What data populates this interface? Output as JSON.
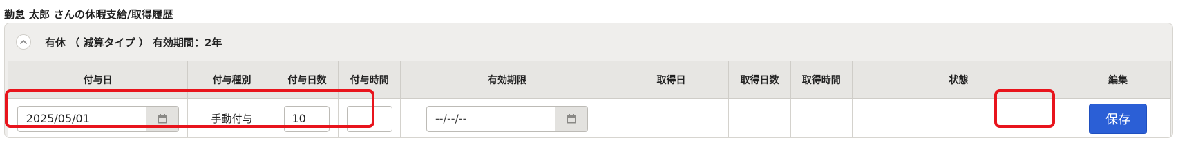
{
  "page": {
    "title": "勤怠 太郎 さんの休暇支給/取得履歴"
  },
  "panel": {
    "title": "有休 （ 減算タイプ ） 有効期間：2年"
  },
  "table": {
    "headers": [
      "付与日",
      "付与種別",
      "付与日数",
      "付与時間",
      "有効期限",
      "取得日",
      "取得日数",
      "取得時間",
      "状態",
      "編集"
    ],
    "row": {
      "grant_date": "2025/05/01",
      "grant_type": "手動付与",
      "grant_days": "10",
      "grant_hours": "",
      "expiry_placeholder": "--/--/--",
      "acquired_date": "",
      "acquired_days": "",
      "acquired_hours": "",
      "status": "",
      "save_label": "保存"
    }
  },
  "icons": {
    "collapse": "chevron-up-icon",
    "calendar": "calendar-icon"
  },
  "colors": {
    "save_button": "#2b5fd6",
    "highlight": "#e8141c",
    "panel_bg": "#efeeec"
  }
}
